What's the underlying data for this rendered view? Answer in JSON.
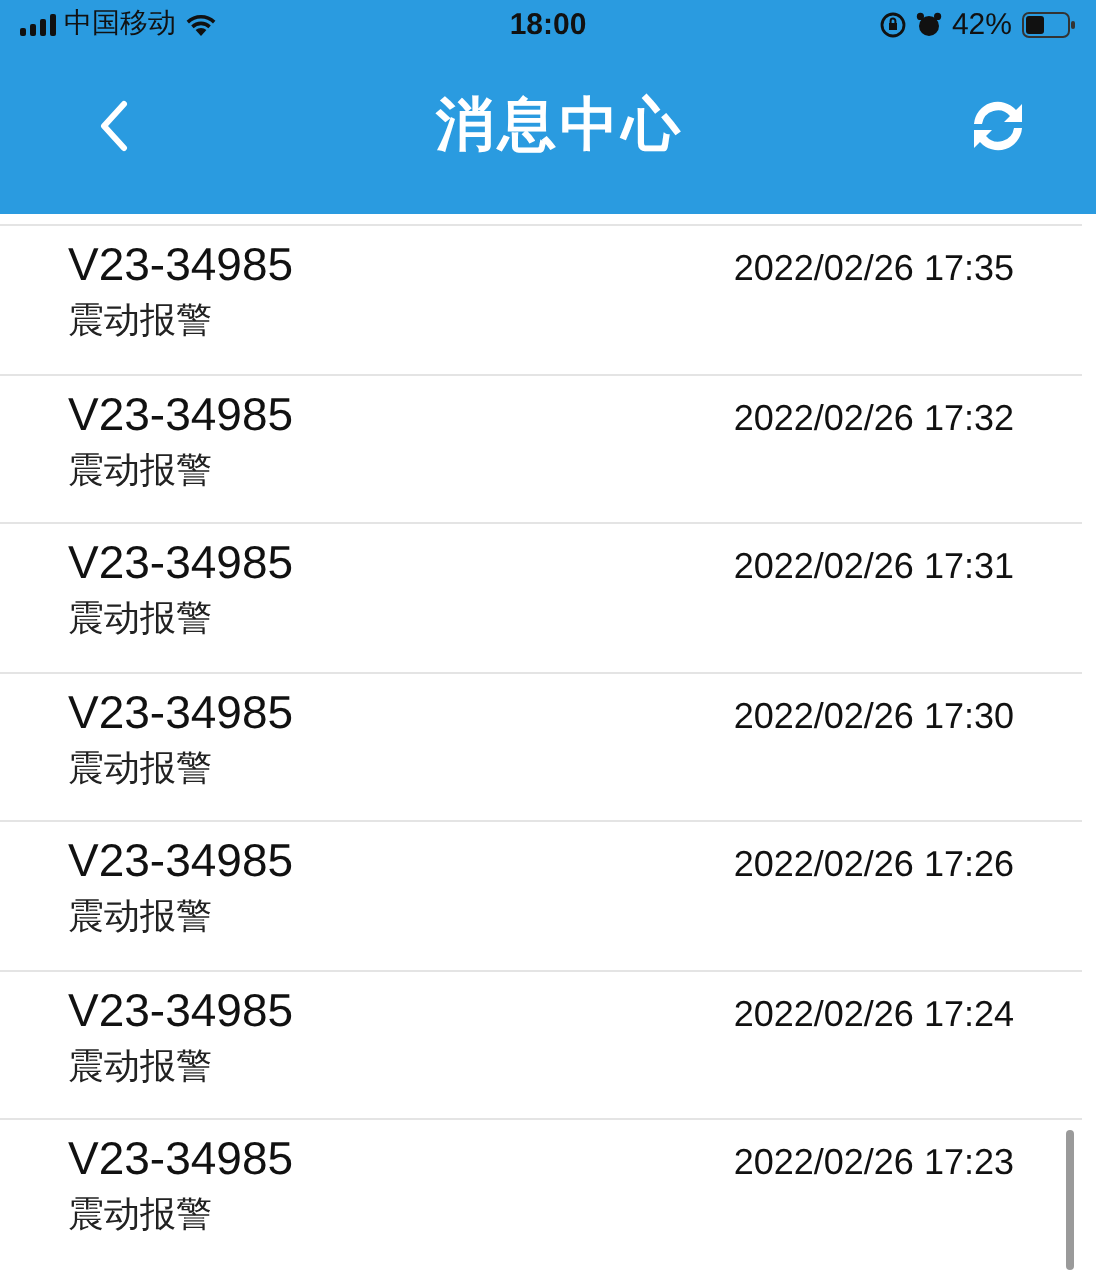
{
  "status_bar": {
    "carrier": "中国移动",
    "time": "18:00",
    "battery": "42%"
  },
  "header": {
    "title": "消息中心"
  },
  "messages": [
    {
      "device": "V23-34985",
      "event": "震动报警",
      "time": "2022/02/26 17:35"
    },
    {
      "device": "V23-34985",
      "event": "震动报警",
      "time": "2022/02/26 17:32"
    },
    {
      "device": "V23-34985",
      "event": "震动报警",
      "time": "2022/02/26 17:31"
    },
    {
      "device": "V23-34985",
      "event": "震动报警",
      "time": "2022/02/26 17:30"
    },
    {
      "device": "V23-34985",
      "event": "震动报警",
      "time": "2022/02/26 17:26"
    },
    {
      "device": "V23-34985",
      "event": "震动报警",
      "time": "2022/02/26 17:24"
    },
    {
      "device": "V23-34985",
      "event": "震动报警",
      "time": "2022/02/26 17:23"
    }
  ]
}
